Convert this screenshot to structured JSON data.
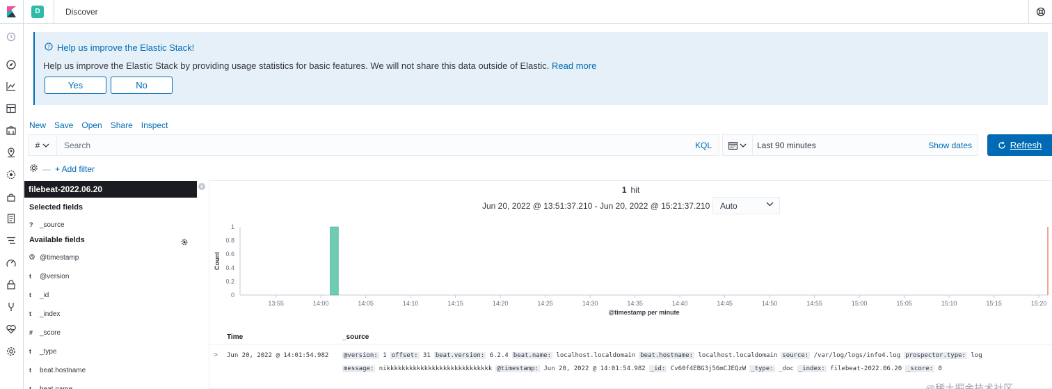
{
  "app": {
    "name": "Kibana",
    "breadcrumb": "Discover",
    "space_initial": "D"
  },
  "nav_icons": [
    "recent-icon",
    "discover-icon",
    "visualize-icon",
    "dashboard-icon",
    "canvas-icon",
    "maps-icon",
    "ml-icon",
    "infrastructure-icon",
    "logs-icon",
    "apm-icon",
    "uptime-icon",
    "siem-icon",
    "dev-tools-icon",
    "monitoring-icon",
    "management-icon"
  ],
  "callout": {
    "title": "Help us improve the Elastic Stack!",
    "body": "Help us improve the Elastic Stack by providing usage statistics for basic features. We will not share this data outside of Elastic.",
    "link": "Read more",
    "yes": "Yes",
    "no": "No"
  },
  "menu": {
    "new": "New",
    "save": "Save",
    "open": "Open",
    "share": "Share",
    "inspect": "Inspect"
  },
  "query": {
    "lang_symbol": "#",
    "placeholder": "Search",
    "kql": "KQL"
  },
  "datepicker": {
    "range": "Last 90 minutes",
    "show_dates": "Show dates"
  },
  "refresh": "Refresh",
  "filter": {
    "add": "+ Add filter",
    "dash": "—"
  },
  "sidebar": {
    "index": "filebeat-2022.06.20",
    "selected_title": "Selected fields",
    "selected": [
      {
        "type": "?",
        "name": "_source"
      }
    ],
    "available_title": "Available fields",
    "available": [
      {
        "type": "clock",
        "name": "@timestamp"
      },
      {
        "type": "t",
        "name": "@version"
      },
      {
        "type": "t",
        "name": "_id"
      },
      {
        "type": "t",
        "name": "_index"
      },
      {
        "type": "#",
        "name": "_score"
      },
      {
        "type": "t",
        "name": "_type"
      },
      {
        "type": "t",
        "name": "beat.hostname"
      },
      {
        "type": "t",
        "name": "beat.name"
      }
    ]
  },
  "results": {
    "hits_count": "1",
    "hits_label": "hit",
    "time_range": "Jun 20, 2022 @ 13:51:37.210 - Jun 20, 2022 @ 15:21:37.210 —",
    "interval": "Auto",
    "col_time": "Time",
    "col_source": "_source",
    "rows": [
      {
        "time": "Jun 20, 2022 @ 14:01:54.982",
        "line1": [
          [
            "@version:",
            "1"
          ],
          [
            "offset:",
            "31"
          ],
          [
            "beat.version:",
            "6.2.4"
          ],
          [
            "beat.name:",
            "localhost.localdomain"
          ],
          [
            "beat.hostname:",
            "localhost.localdomain"
          ],
          [
            "source:",
            "/var/log/logs/info4.log"
          ],
          [
            "prospector.type:",
            "log"
          ]
        ],
        "line2": [
          [
            "message:",
            "nikkkkkkkkkkkkkkkkkkkkkkkkkkkk"
          ],
          [
            "@timestamp:",
            "Jun 20, 2022 @ 14:01:54.982"
          ],
          [
            "_id:",
            "Cv60f4EBG3j56mCJEQzW"
          ],
          [
            "_type:",
            "_doc"
          ],
          [
            "_index:",
            "filebeat-2022.06.20"
          ],
          [
            "_score:",
            "0"
          ]
        ]
      }
    ]
  },
  "watermark": "@稀土掘金技术社区",
  "chart_data": {
    "type": "bar",
    "title": "",
    "xlabel": "@timestamp per minute",
    "ylabel": "Count",
    "ylim": [
      0,
      1
    ],
    "yticks": [
      "0",
      "0.2",
      "0.4",
      "0.6",
      "0.8",
      "1"
    ],
    "xticks": [
      "13:55",
      "14:00",
      "14:05",
      "14:10",
      "14:15",
      "14:20",
      "14:25",
      "14:30",
      "14:35",
      "14:40",
      "14:45",
      "14:50",
      "14:55",
      "15:00",
      "15:05",
      "15:10",
      "15:15",
      "15:20"
    ],
    "x_start_minute": "13:51",
    "x_end_minute": "15:21",
    "bars": [
      {
        "minute": "14:01",
        "count": 1
      }
    ],
    "bar_color": "#6dccb1",
    "end_marker_color": "#e7664c",
    "grid": false
  }
}
